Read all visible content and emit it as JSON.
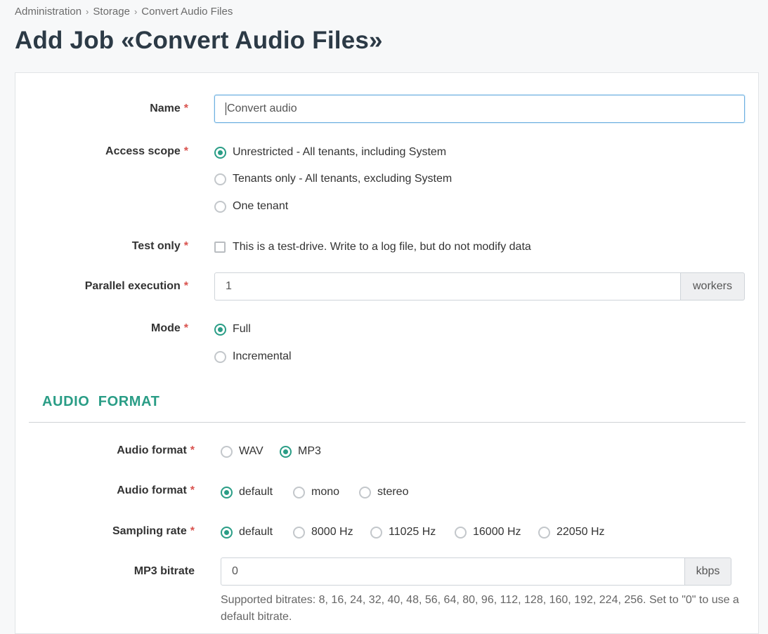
{
  "breadcrumb": [
    "Administration",
    "Storage",
    "Convert Audio Files"
  ],
  "page_title": "Add Job «Convert Audio Files»",
  "colors": {
    "accent": "#2a9d86",
    "required": "#d9534f"
  },
  "form": {
    "name": {
      "label": "Name",
      "required": "*",
      "value": "Convert audio"
    },
    "access_scope": {
      "label": "Access scope",
      "required": "*",
      "options": [
        {
          "label": "Unrestricted - All tenants, including System",
          "selected": true
        },
        {
          "label": "Tenants only - All tenants, excluding System",
          "selected": false
        },
        {
          "label": "One tenant",
          "selected": false
        }
      ]
    },
    "test_only": {
      "label": "Test only",
      "required": "*",
      "checkbox_label": "This is a test-drive. Write to a log file, but do not modify data",
      "checked": false
    },
    "parallel": {
      "label": "Parallel execution",
      "required": "*",
      "value": "1",
      "addon": "workers"
    },
    "mode": {
      "label": "Mode",
      "required": "*",
      "options": [
        {
          "label": "Full",
          "selected": true
        },
        {
          "label": "Incremental",
          "selected": false
        }
      ]
    }
  },
  "audio_section": {
    "title": "AUDIO  FORMAT",
    "format": {
      "label": "Audio format",
      "required": "*",
      "options": [
        {
          "label": "WAV",
          "selected": false
        },
        {
          "label": "MP3",
          "selected": true
        }
      ]
    },
    "channels": {
      "label": "Audio format",
      "required": "*",
      "options": [
        {
          "label": "default",
          "selected": true
        },
        {
          "label": "mono",
          "selected": false
        },
        {
          "label": "stereo",
          "selected": false
        }
      ]
    },
    "sampling": {
      "label": "Sampling rate",
      "required": "*",
      "options": [
        {
          "label": "default",
          "selected": true
        },
        {
          "label": "8000 Hz",
          "selected": false
        },
        {
          "label": "11025 Hz",
          "selected": false
        },
        {
          "label": "16000 Hz",
          "selected": false
        },
        {
          "label": "22050 Hz",
          "selected": false
        }
      ]
    },
    "bitrate": {
      "label": "MP3 bitrate",
      "value": "0",
      "addon": "kbps",
      "help": "Supported bitrates: 8, 16, 24, 32, 40, 48, 56, 64, 80, 96, 112, 128, 160, 192, 224, 256. Set to \"0\" to use a default bitrate."
    }
  }
}
